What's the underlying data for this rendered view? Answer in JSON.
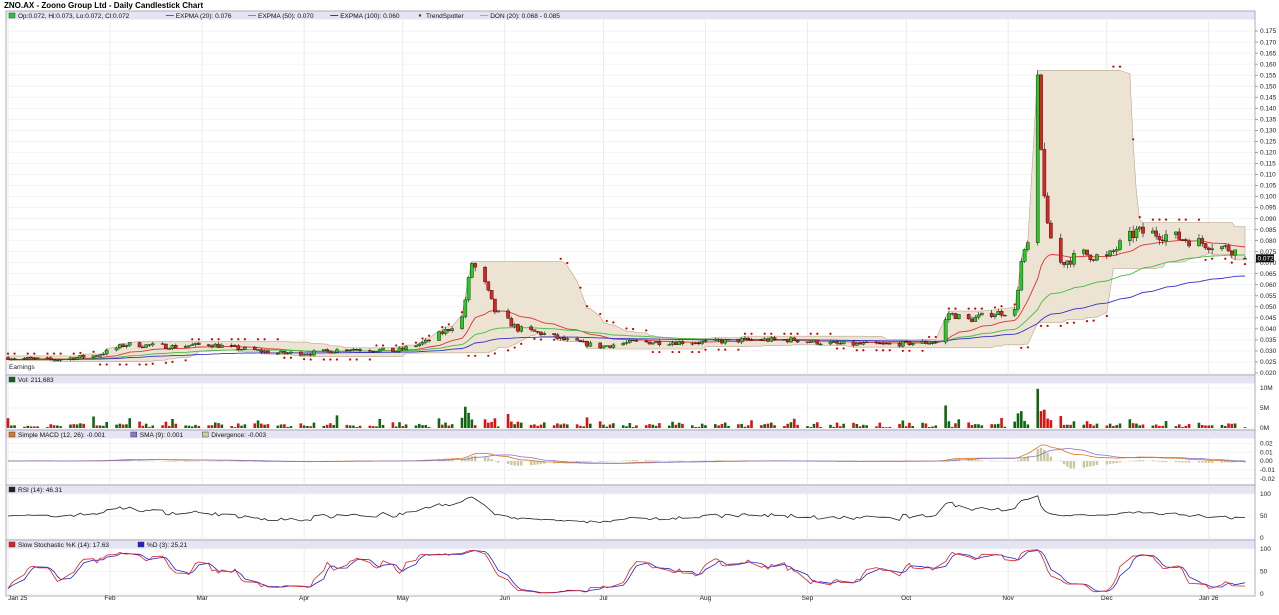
{
  "chart_title": "ZNO.AX - Zoono Group Ltd - Daily Candlestick Chart",
  "colors": {
    "up": "#22cc22",
    "down": "#dd2222",
    "ema20": "#dd3333",
    "ema50": "#44bb44",
    "ema100": "#3333cc",
    "donchian_fill": "#ede3d2",
    "donchian_line": "#b8a88a",
    "trendspotter": "#cc0000",
    "vol_up": "#116611",
    "vol_down": "#dd1111",
    "macd": "#dd7722",
    "signal": "#8877cc",
    "divergence": "#cbc8a0",
    "rsi": "#222222",
    "stoch_k": "#dd2222",
    "stoch_d": "#2222cc",
    "legend_bg": "#e4e4f2"
  },
  "legends": {
    "price": [
      {
        "label": "Op:0.072, Hi:0.073, Lo:0.072, Cl:0.072",
        "color": "#22cc22",
        "marker": "box"
      },
      {
        "label": "EXPMA (20): 0.076",
        "color": "#dd3333",
        "marker": "line"
      },
      {
        "label": "EXPMA (50): 0.070",
        "color": "#44bb44",
        "marker": "line"
      },
      {
        "label": "EXPMA (100): 0.060",
        "color": "#3333cc",
        "marker": "line"
      },
      {
        "label": "TrendSpotter",
        "color": "#cc0000",
        "marker": "dot"
      },
      {
        "label": "DON (20): 0.068 - 0.085",
        "color": "#b8a88a",
        "marker": "line"
      }
    ],
    "volume": [
      {
        "label": "Vol: 211,683",
        "color": "#116611",
        "marker": "box"
      }
    ],
    "macd": [
      {
        "label": "Simple MACD (12, 26): -0.001",
        "color": "#dd7722",
        "marker": "box"
      },
      {
        "label": "SMA (9): 0.001",
        "color": "#8877cc",
        "marker": "box"
      },
      {
        "label": "Divergence: -0.003",
        "color": "#cbc8a0",
        "marker": "box"
      }
    ],
    "rsi": [
      {
        "label": "RSI (14): 46.31",
        "color": "#222222",
        "marker": "box"
      }
    ],
    "stoch": [
      {
        "label": "Slow Stochastic %K (14): 17.63",
        "color": "#dd2222",
        "marker": "box"
      },
      {
        "label": "%D (3): 25.21",
        "color": "#2222cc",
        "marker": "box"
      }
    ]
  },
  "earnings_label": "Earnings",
  "last_price_label": "0.072",
  "chart_data": {
    "type": "candlestick",
    "symbol": "ZNO.AX",
    "x_range": [
      "2025-01-01",
      "2026-01-12"
    ],
    "x_tick_labels": [
      "Jan 25",
      "Feb",
      "Mar",
      "Apr",
      "May",
      "Jun",
      "Jul",
      "Aug",
      "Sep",
      "Oct",
      "Nov",
      "Dec",
      "Jan 26"
    ],
    "last_bar": {
      "open": 0.072,
      "high": 0.073,
      "low": 0.072,
      "close": 0.072
    },
    "price": {
      "ylim": [
        0.02,
        0.18
      ],
      "y_ticks": [
        0.02,
        0.025,
        0.03,
        0.035,
        0.04,
        0.045,
        0.05,
        0.055,
        0.06,
        0.065,
        0.07,
        0.075,
        0.08,
        0.085,
        0.09,
        0.095,
        0.1,
        0.105,
        0.11,
        0.115,
        0.12,
        0.125,
        0.13,
        0.135,
        0.14,
        0.145,
        0.15,
        0.155,
        0.16,
        0.165,
        0.17,
        0.175
      ]
    },
    "close_path": [
      [
        "2025-01-01",
        0.027
      ],
      [
        "2025-01-15",
        0.026
      ],
      [
        "2025-01-28",
        0.028
      ],
      [
        "2025-02-06",
        0.033
      ],
      [
        "2025-02-20",
        0.032
      ],
      [
        "2025-03-03",
        0.033
      ],
      [
        "2025-03-13",
        0.031
      ],
      [
        "2025-03-24",
        0.029
      ],
      [
        "2025-04-03",
        0.029
      ],
      [
        "2025-04-15",
        0.031
      ],
      [
        "2025-04-29",
        0.03
      ],
      [
        "2025-05-08",
        0.034
      ],
      [
        "2025-05-15",
        0.04
      ],
      [
        "2025-05-19",
        0.045
      ],
      [
        "2025-05-22",
        0.07
      ],
      [
        "2025-05-26",
        0.06
      ],
      [
        "2025-05-29",
        0.048
      ],
      [
        "2025-06-05",
        0.04
      ],
      [
        "2025-06-12",
        0.038
      ],
      [
        "2025-06-19",
        0.035
      ],
      [
        "2025-06-30",
        0.032
      ],
      [
        "2025-07-10",
        0.034
      ],
      [
        "2025-07-21",
        0.034
      ],
      [
        "2025-08-01",
        0.034
      ],
      [
        "2025-08-14",
        0.035
      ],
      [
        "2025-08-28",
        0.035
      ],
      [
        "2025-09-11",
        0.033
      ],
      [
        "2025-09-25",
        0.033
      ],
      [
        "2025-10-10",
        0.034
      ],
      [
        "2025-10-14",
        0.047
      ],
      [
        "2025-10-20",
        0.044
      ],
      [
        "2025-10-27",
        0.047
      ],
      [
        "2025-11-03",
        0.048
      ],
      [
        "2025-11-05",
        0.07
      ],
      [
        "2025-11-07",
        0.078
      ],
      [
        "2025-11-10",
        0.15
      ],
      [
        "2025-11-11",
        0.12
      ],
      [
        "2025-11-13",
        0.085
      ],
      [
        "2025-11-17",
        0.07
      ],
      [
        "2025-11-24",
        0.074
      ],
      [
        "2025-12-01",
        0.072
      ],
      [
        "2025-12-05",
        0.078
      ],
      [
        "2025-12-10",
        0.084
      ],
      [
        "2025-12-17",
        0.083
      ],
      [
        "2025-12-24",
        0.081
      ],
      [
        "2026-01-02",
        0.078
      ],
      [
        "2026-01-08",
        0.076
      ],
      [
        "2026-01-12",
        0.072
      ]
    ],
    "volume": {
      "y_tick_labels": [
        "0M",
        "5M",
        "10M"
      ],
      "ylim": [
        0,
        11000000
      ],
      "last": 211683
    },
    "macd": {
      "y_tick_labels": [
        "-0.02",
        "-0.01",
        "0.00",
        "0.01",
        "0.02"
      ],
      "ylim": [
        -0.025,
        0.025
      ],
      "macd": -0.001,
      "signal": 0.001,
      "divergence": -0.003
    },
    "rsi": {
      "y_tick_labels": [
        "0",
        "50",
        "100"
      ],
      "ylim": [
        0,
        100
      ],
      "last": 46.31
    },
    "stoch": {
      "y_tick_labels": [
        "0",
        "50",
        "100"
      ],
      "ylim": [
        0,
        100
      ],
      "k": 17.63,
      "d": 25.21
    }
  }
}
